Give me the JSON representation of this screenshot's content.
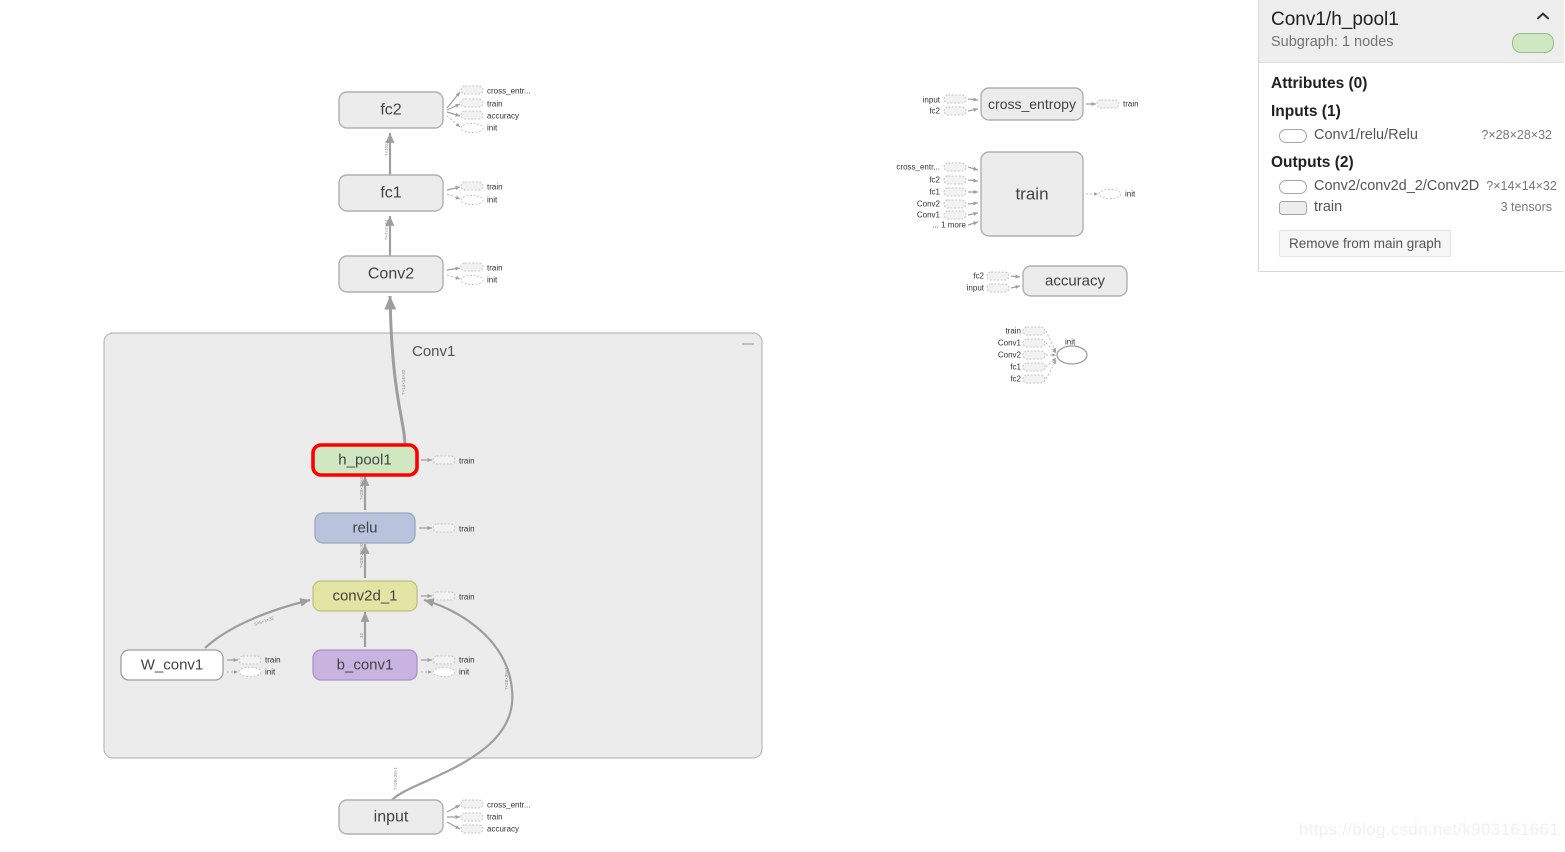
{
  "watermark": "https://blog.csdn.net/k903161661",
  "info_panel": {
    "title": "Conv1/h_pool1",
    "subtitle": "Subgraph: 1 nodes",
    "collapse_icon": "chevron-up-icon",
    "color_swatch": "#cfe8c2",
    "attributes_heading": "Attributes (0)",
    "inputs_heading": "Inputs (1)",
    "inputs": [
      {
        "glyph": "op-ellipse-icon",
        "name": "Conv1/relu/Relu",
        "shape": "?×28×28×32"
      }
    ],
    "outputs_heading": "Outputs (2)",
    "outputs": [
      {
        "glyph": "op-ellipse-icon",
        "name": "Conv2/conv2d_2/Conv2D",
        "shape": "?×14×14×32"
      },
      {
        "glyph": "group-rect-icon",
        "name": "train",
        "shape": "3 tensors"
      }
    ],
    "remove_button": "Remove from main graph"
  },
  "graph": {
    "group": {
      "label": "Conv1",
      "collapse_icon": "minimize-icon"
    },
    "main_column": [
      {
        "id": "fc2",
        "label": "fc2",
        "type": "group"
      },
      {
        "id": "fc1",
        "label": "fc1",
        "type": "group"
      },
      {
        "id": "Conv2",
        "label": "Conv2",
        "type": "group"
      },
      {
        "id": "h_pool1",
        "label": "h_pool1",
        "type": "group",
        "color": "#cfe8c2",
        "selected": true
      },
      {
        "id": "relu",
        "label": "relu",
        "type": "group",
        "color": "#b8c4de"
      },
      {
        "id": "conv2d_1",
        "label": "conv2d_1",
        "type": "group",
        "color": "#e4e4a4"
      },
      {
        "id": "W_conv1",
        "label": "W_conv1",
        "type": "op"
      },
      {
        "id": "b_conv1",
        "label": "b_conv1",
        "type": "group",
        "color": "#c9b3e0"
      },
      {
        "id": "input",
        "label": "input",
        "type": "group"
      }
    ],
    "aux_nodes": [
      {
        "id": "cross_entropy",
        "label": "cross_entropy",
        "inputs": [
          "input",
          "fc2"
        ],
        "outputs": [
          "train"
        ]
      },
      {
        "id": "train",
        "label": "train",
        "inputs": [
          "cross_entr...",
          "fc2",
          "fc1",
          "Conv2",
          "Conv1",
          "... 1 more"
        ],
        "outputs": [
          "init"
        ]
      },
      {
        "id": "accuracy",
        "label": "accuracy",
        "inputs": [
          "fc2",
          "input"
        ],
        "outputs": []
      },
      {
        "id": "init",
        "label": "init",
        "inputs": [
          "train",
          "Conv1",
          "Conv2",
          "fc1",
          "fc2"
        ],
        "outputs": []
      }
    ],
    "annotations": {
      "fc2": [
        "cross_entr...",
        "train",
        "accuracy",
        "init"
      ],
      "fc1": [
        "train",
        "init"
      ],
      "Conv2": [
        "train",
        "init"
      ],
      "h_pool1": [
        "train"
      ],
      "relu": [
        "train"
      ],
      "conv2d_1": [
        "train"
      ],
      "W_conv1": [
        "train",
        "init"
      ],
      "b_conv1": [
        "train",
        "init"
      ],
      "input": [
        "cross_entr...",
        "train",
        "accuracy"
      ]
    },
    "edge_labels": {
      "fc1_to_fc2": "?×1024",
      "Conv2_to_fc1": "?×7×7×64",
      "h_pool1_out": "?×14×14×32",
      "relu_to_h_pool1": "?×28×28×32",
      "conv2d_1_to_relu": "?×28×28×32",
      "W_conv1_to_conv2d_1": "5×5×1×32",
      "b_conv1_to_conv2d_1": "32",
      "input_to_conv2d_1": "?×28×28×1"
    }
  }
}
